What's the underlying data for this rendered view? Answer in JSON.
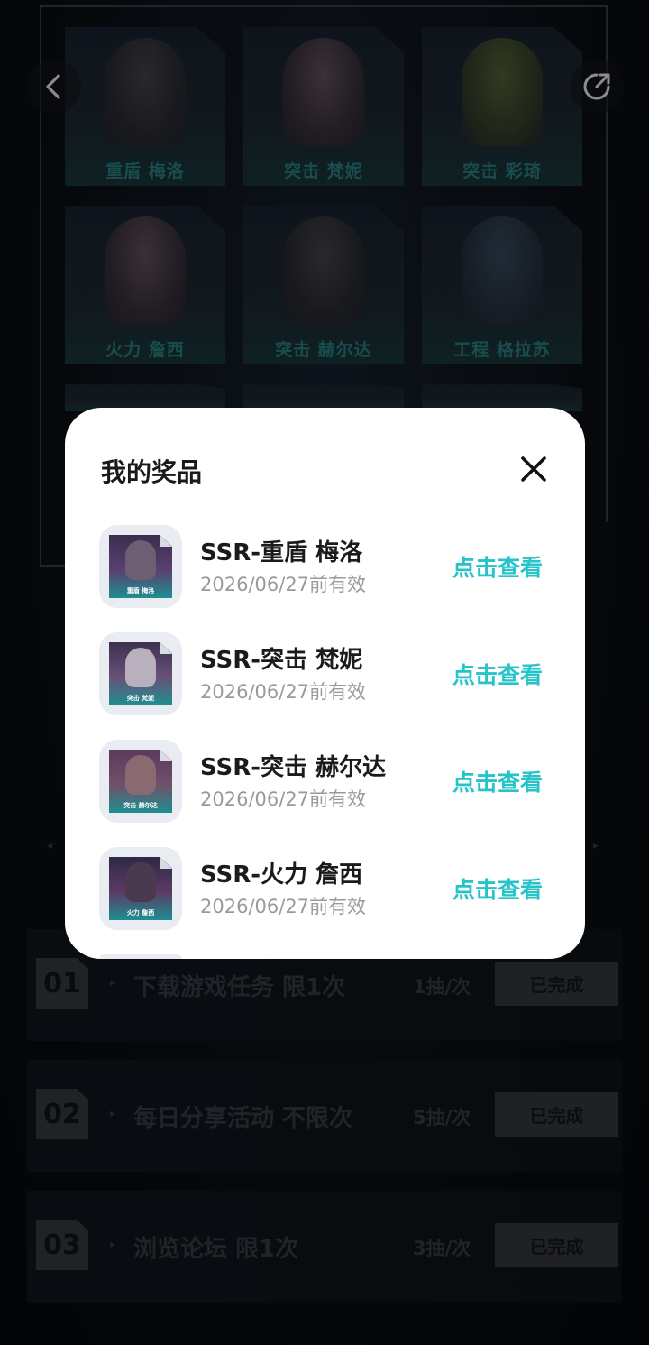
{
  "background": {
    "characters": [
      {
        "label": "重盾 梅洛",
        "tone": "dark"
      },
      {
        "label": "突击 梵妮",
        "tone": "pink"
      },
      {
        "label": "突击 彩琦",
        "tone": "green"
      },
      {
        "label": "火力 詹西",
        "tone": "pink"
      },
      {
        "label": "突击 赫尔达",
        "tone": "dark"
      },
      {
        "label": "工程 格拉苏",
        "tone": "blue"
      }
    ],
    "tasks": [
      {
        "num": "01",
        "title": "下载游戏任务 限1次",
        "rate": "1抽/次",
        "status": "已完成"
      },
      {
        "num": "02",
        "title": "每日分享活动 不限次",
        "rate": "5抽/次",
        "status": "已完成"
      },
      {
        "num": "03",
        "title": "浏览论坛 限1次",
        "rate": "3抽/次",
        "status": "已完成"
      }
    ]
  },
  "modal": {
    "title": "我的奖品",
    "prizes": [
      {
        "name": "SSR-重盾 梅洛",
        "validity": "2026/06/27前有效",
        "action": "点击查看",
        "thumb_label": "重盾 梅洛"
      },
      {
        "name": "SSR-突击 梵妮",
        "validity": "2026/06/27前有效",
        "action": "点击查看",
        "thumb_label": "突击 梵妮"
      },
      {
        "name": "SSR-突击 赫尔达",
        "validity": "2026/06/27前有效",
        "action": "点击查看",
        "thumb_label": "突击 赫尔达"
      },
      {
        "name": "SSR-火力 詹西",
        "validity": "2026/06/27前有效",
        "action": "点击查看",
        "thumb_label": "火力 詹西"
      }
    ]
  },
  "icons": {
    "back": "chevron-left-icon",
    "share": "share-icon",
    "close": "close-icon"
  },
  "colors": {
    "accent": "#24c4c8",
    "modal_bg": "#ffffff",
    "page_bg": "#07090d"
  }
}
